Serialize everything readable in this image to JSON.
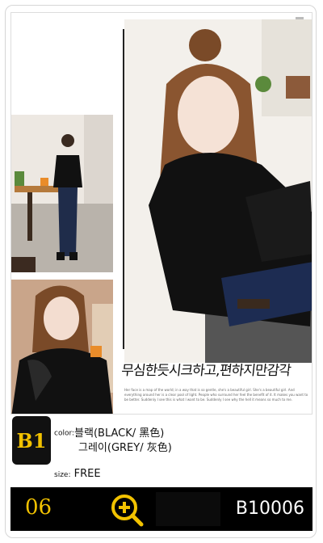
{
  "photo": {
    "handwriting": "무심한듯시크하고,편하지만감각",
    "fine_print": "Her face is a map of the world; in a way that is so gentle, she's a beautiful girl. She's a beautiful girl. And everything around her is a clear pool of light. People who surround her feel the benefit of it. It makes you want to be better. Suddenly I see this is what I want to be. Suddenly I see why the hell it means so much to me."
  },
  "product": {
    "badge": "B1",
    "color_label": "color:",
    "color_black": "블랙(BLACK/ 黑色)",
    "color_grey": "그레이(GREY/ 灰色)",
    "size_label": "size:",
    "size_value": "FREE"
  },
  "footer": {
    "lot_number": "06",
    "code": "B10006"
  },
  "colors": {
    "accent": "#f2c200",
    "dark": "#000000"
  },
  "icons": {
    "zoom": "zoom-plus-icon"
  }
}
